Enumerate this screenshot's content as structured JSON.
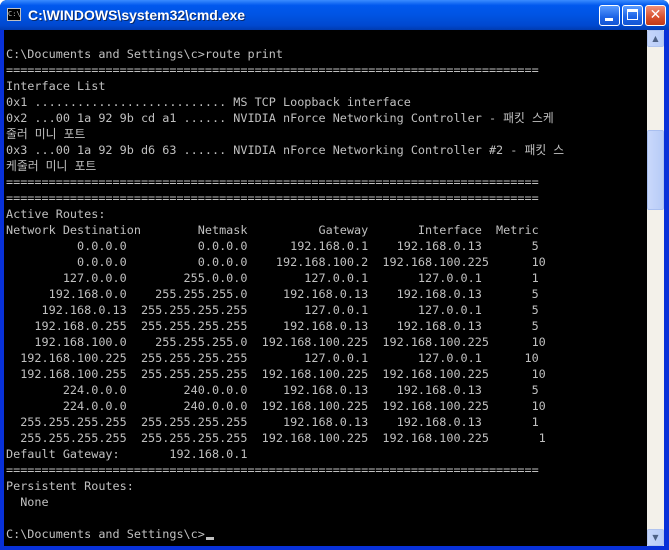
{
  "window": {
    "title": "C:\\WINDOWS\\system32\\cmd.exe",
    "icon_name": "console-app-icon",
    "icon_glyph": "C:\\",
    "buttons": {
      "minimize": "_",
      "maximize": "□",
      "close": "✕"
    }
  },
  "colors": {
    "console_bg": "#000000",
    "console_fg": "#c0c0c0",
    "titlebar": "#0054e3"
  },
  "console": {
    "lines": [
      "C:\\Documents and Settings\\c>route print",
      "===========================================================================",
      "Interface List",
      "0x1 ........................... MS TCP Loopback interface",
      "0x2 ...00 1a 92 9b cd a1 ...... NVIDIA nForce Networking Controller - 패킷 스케",
      "줄러 미니 포트",
      "0x3 ...00 1a 92 9b d6 63 ...... NVIDIA nForce Networking Controller #2 - 패킷 스",
      "케줄러 미니 포트",
      "===========================================================================",
      "===========================================================================",
      "Active Routes:",
      "Network Destination        Netmask          Gateway       Interface  Metric",
      "          0.0.0.0          0.0.0.0      192.168.0.1    192.168.0.13       5",
      "          0.0.0.0          0.0.0.0    192.168.100.2  192.168.100.225      10",
      "        127.0.0.0        255.0.0.0        127.0.0.1       127.0.0.1       1",
      "      192.168.0.0    255.255.255.0     192.168.0.13    192.168.0.13       5",
      "     192.168.0.13  255.255.255.255        127.0.0.1       127.0.0.1       5",
      "    192.168.0.255  255.255.255.255     192.168.0.13    192.168.0.13       5",
      "    192.168.100.0    255.255.255.0  192.168.100.225  192.168.100.225      10",
      "  192.168.100.225  255.255.255.255        127.0.0.1       127.0.0.1      10",
      "  192.168.100.255  255.255.255.255  192.168.100.225  192.168.100.225      10",
      "        224.0.0.0        240.0.0.0     192.168.0.13    192.168.0.13       5",
      "        224.0.0.0        240.0.0.0  192.168.100.225  192.168.100.225      10",
      "  255.255.255.255  255.255.255.255     192.168.0.13    192.168.0.13       1",
      "  255.255.255.255  255.255.255.255  192.168.100.225  192.168.100.225       1",
      "Default Gateway:       192.168.0.1",
      "===========================================================================",
      "Persistent Routes:",
      "  None",
      "",
      "C:\\Documents and Settings\\c>"
    ]
  },
  "scrollbar": {
    "up_glyph": "▲",
    "down_glyph": "▼"
  }
}
